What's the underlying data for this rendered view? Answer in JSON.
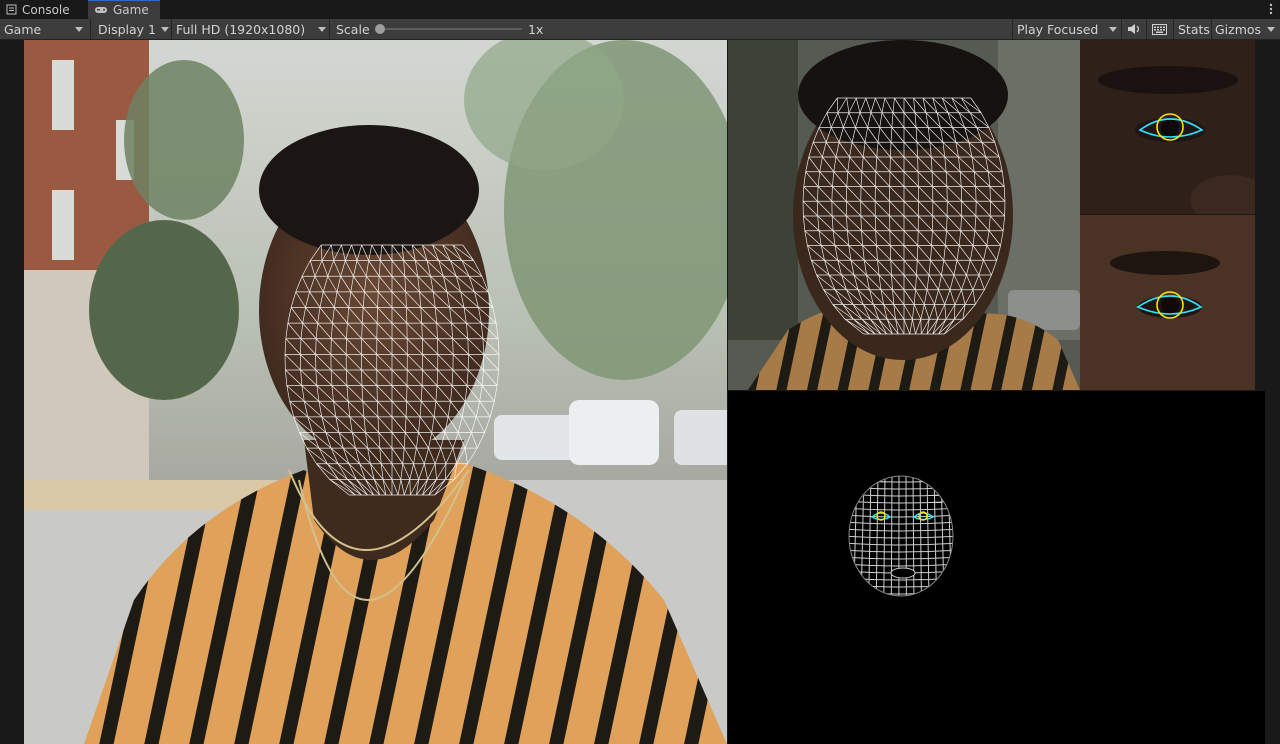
{
  "tabs": [
    {
      "label": "Console",
      "icon": "console-icon",
      "active": false
    },
    {
      "label": "Game",
      "icon": "gamepad-icon",
      "active": true
    }
  ],
  "toolbar": {
    "mode": "Game",
    "display": "Display 1",
    "resolution": "Full HD (1920x1080)",
    "scale_label": "Scale",
    "scale_value": "1x",
    "scale_fraction": 0.0,
    "play_mode": "Play Focused",
    "audio_icon": "speaker-icon",
    "keyboard_icon": "keyboard-icon",
    "stats": "Stats",
    "gizmos": "Gizmos"
  },
  "colors": {
    "tab_accent": "#2a6ad1",
    "toolbar_bg": "#3c3c3c",
    "mesh": "#ffffff",
    "iris": "#ffe100",
    "eye_contour": "#2fe3ff"
  },
  "panels": {
    "main": "face-camera-view",
    "top_right": "face-crop-view",
    "eye_left": "left-eye-crop",
    "eye_right": "right-eye-crop",
    "bottom": "face-mesh-canonical-view"
  }
}
